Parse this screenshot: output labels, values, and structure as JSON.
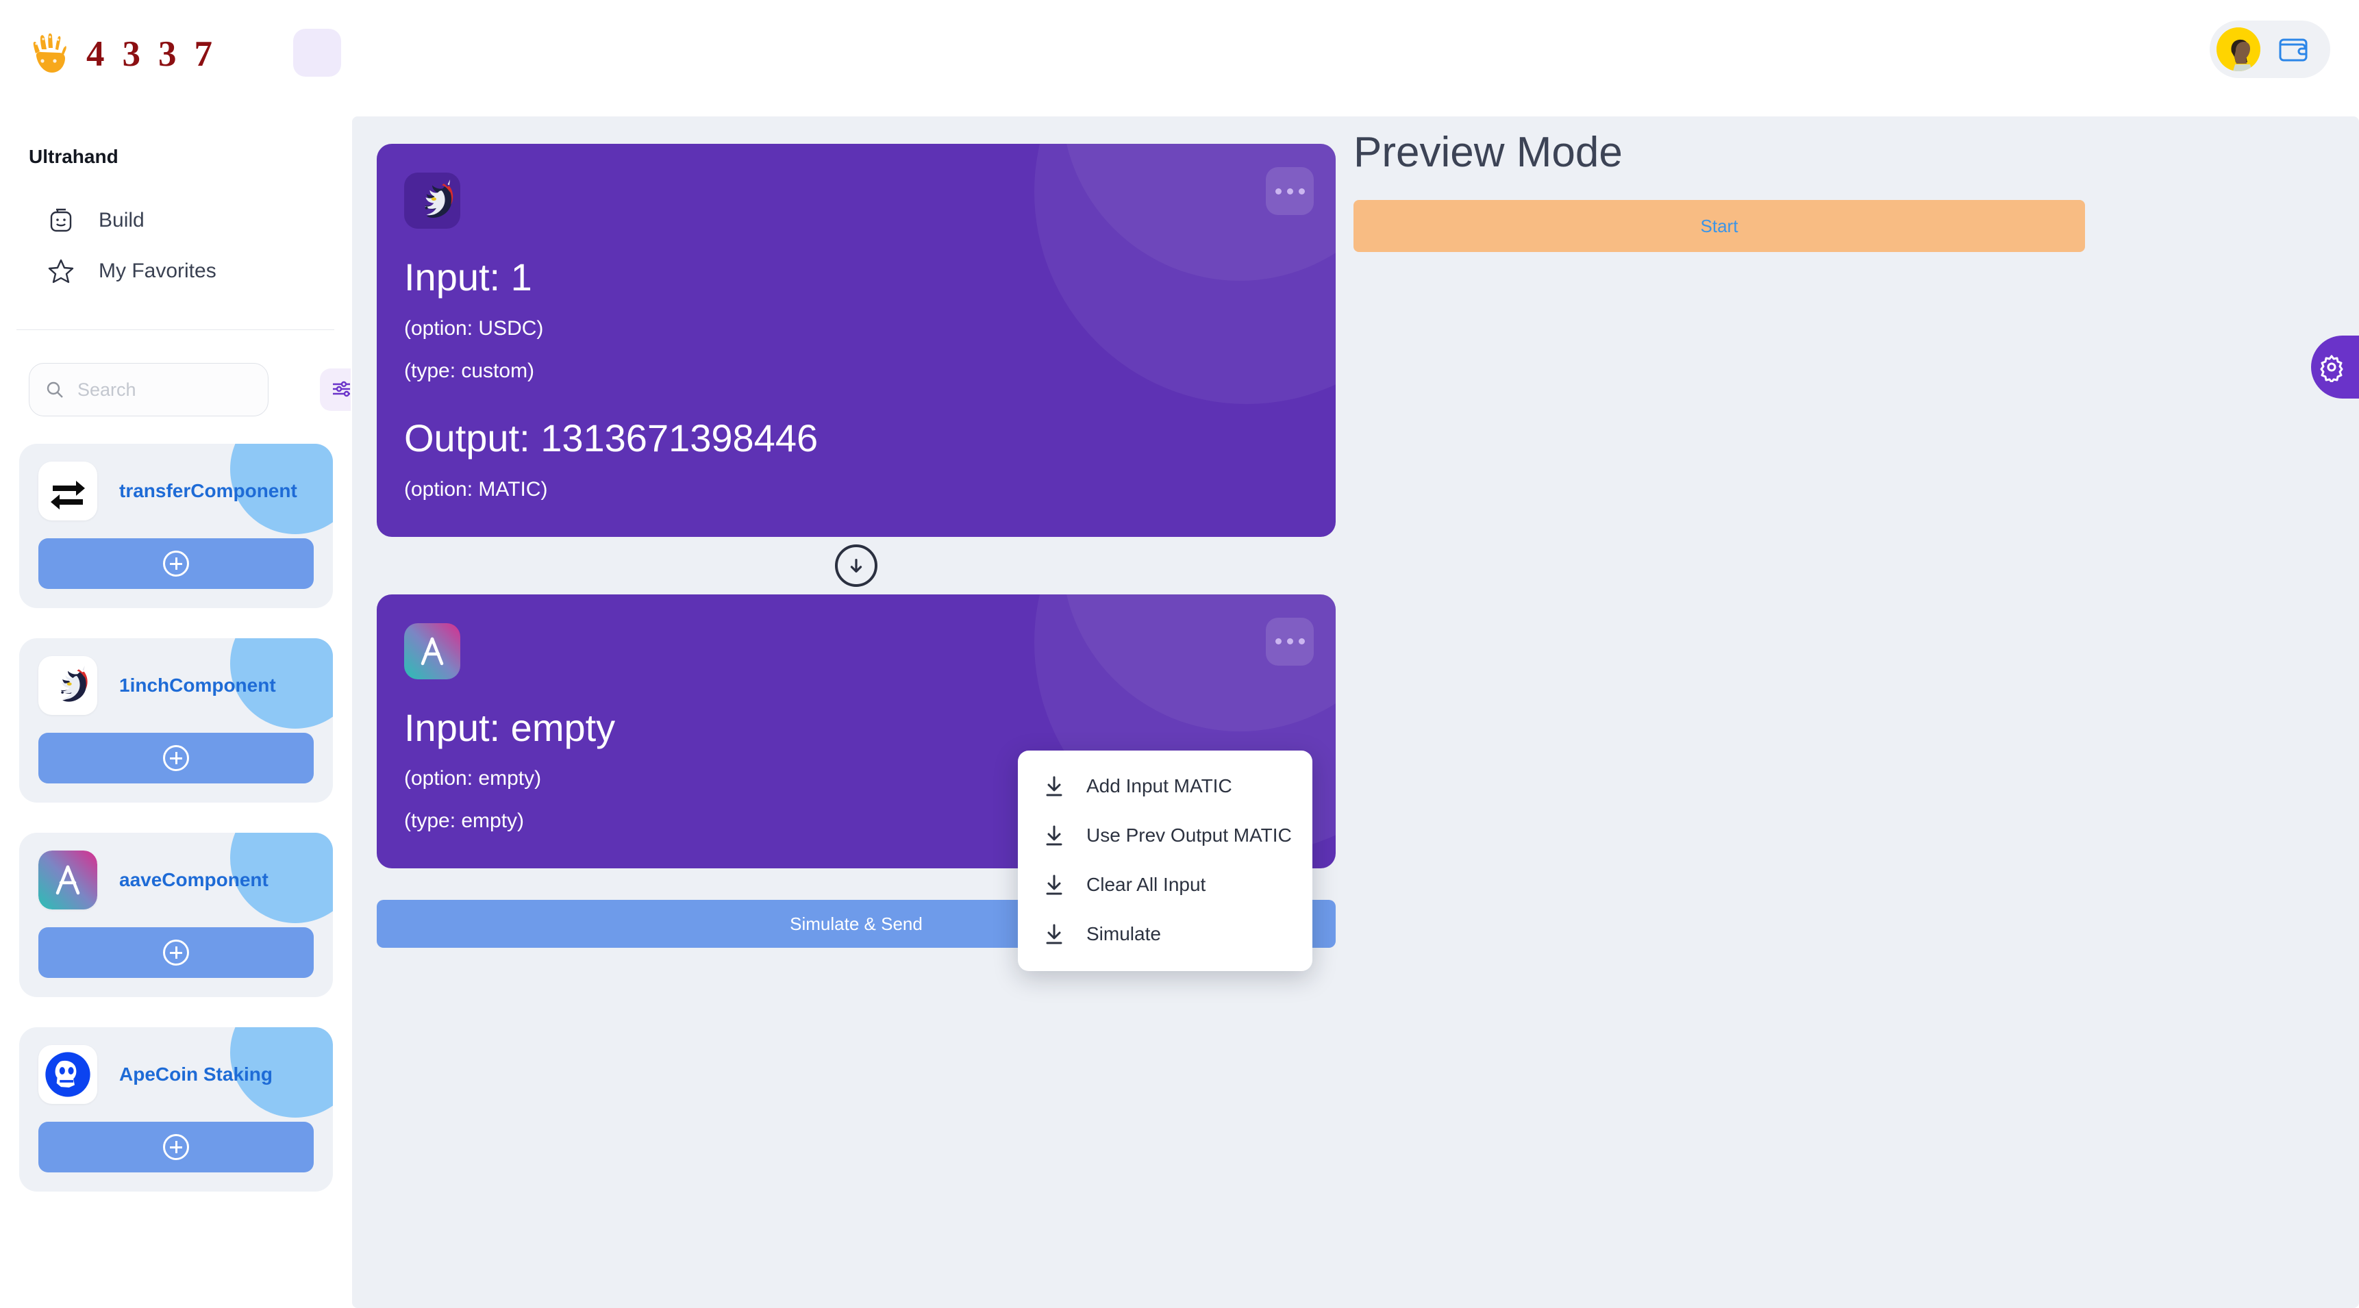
{
  "app": {
    "brand_digits": [
      "4",
      "3",
      "3",
      "7"
    ],
    "brand_logo_icon": "skeleton-hand-icon",
    "menu_icon": "hamburger-icon",
    "avatar_icon": "user-avatar",
    "wallet_icon": "wallet-icon"
  },
  "sidebar": {
    "title": "Ultrahand",
    "nav": [
      {
        "label": "Build",
        "icon": "lego-head-icon"
      },
      {
        "label": "My Favorites",
        "icon": "star-icon"
      }
    ],
    "search": {
      "placeholder": "Search",
      "value": "",
      "icon": "search-icon",
      "filter_icon": "sliders-icon"
    },
    "components": [
      {
        "name": "transferComponent",
        "icon": "transfer-arrows-icon",
        "add_icon": "plus-circle-icon"
      },
      {
        "name": "1inchComponent",
        "icon": "unicorn-icon",
        "add_icon": "plus-circle-icon"
      },
      {
        "name": "aaveComponent",
        "icon": "aave-ghost-icon",
        "add_icon": "plus-circle-icon"
      },
      {
        "name": "ApeCoin Staking",
        "icon": "ape-skull-icon",
        "add_icon": "plus-circle-icon"
      }
    ]
  },
  "flow": {
    "cards": [
      {
        "icon": "unicorn-icon",
        "menu_icon": "more-dots-icon",
        "input_title": "Input: 1",
        "input_option": "(option: USDC)",
        "input_type": "(type: custom)",
        "output_title": "Output: 1313671398446",
        "output_option": "(option: MATIC)"
      },
      {
        "icon": "aave-ghost-icon",
        "menu_icon": "more-dots-icon",
        "input_title": "Input: empty",
        "input_option": "(option: empty)",
        "input_type": "(type: empty)"
      }
    ],
    "connector_icon": "arrow-down-circle-icon",
    "send_label": "Simulate & Send"
  },
  "dropdown": {
    "items": [
      {
        "label": "Add Input MATIC",
        "icon": "download-icon"
      },
      {
        "label": "Use Prev Output MATIC",
        "icon": "download-icon"
      },
      {
        "label": "Clear All Input",
        "icon": "download-icon"
      },
      {
        "label": "Simulate",
        "icon": "download-icon"
      }
    ]
  },
  "preview": {
    "title": "Preview Mode",
    "start_label": "Start"
  },
  "settings": {
    "icon": "gear-icon"
  },
  "colors": {
    "purple": "#5E32B4",
    "brand_red": "#8C0F12",
    "accent_blue": "#6E9BEA",
    "component_blue": "#1E6BD6",
    "start_orange": "#F8BC83",
    "start_text_blue": "#3B95E8",
    "canvas_bg": "#EDF0F5",
    "settings_purple": "#6A33C9"
  }
}
